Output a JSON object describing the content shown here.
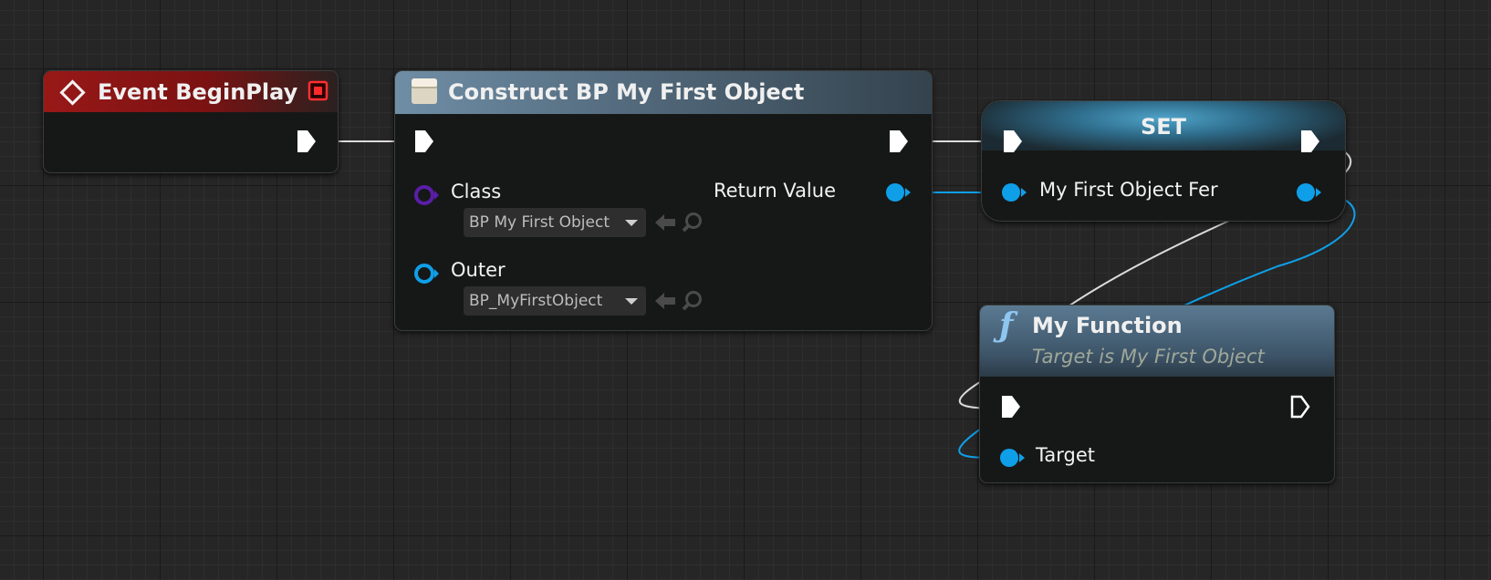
{
  "graph": {
    "nodes": {
      "event_beginplay": {
        "title": "Event BeginPlay"
      },
      "construct": {
        "title": "Construct BP My First Object",
        "class_label": "Class",
        "class_value": "BP My First Object",
        "outer_label": "Outer",
        "outer_value": "BP_MyFirstObject",
        "return_label": "Return Value"
      },
      "set": {
        "title": "SET",
        "var_label": "My First Object Fer"
      },
      "my_function": {
        "title": "My Function",
        "subtitle": "Target is My First Object",
        "target_label": "Target"
      }
    }
  },
  "colors": {
    "background": "#262626",
    "exec_wire": "#dcdcdc",
    "object_wire": "#0f9fe8",
    "class_pin": "#5a1ea8",
    "event_header": "#8e1414",
    "function_header": "#4a6478",
    "set_header": "#3f7fa3"
  },
  "icons": {
    "event": "event-diamond-icon",
    "construct": "construct-object-icon",
    "function": "function-f-icon",
    "browse": "arrow-left-icon",
    "search": "magnifier-icon"
  }
}
